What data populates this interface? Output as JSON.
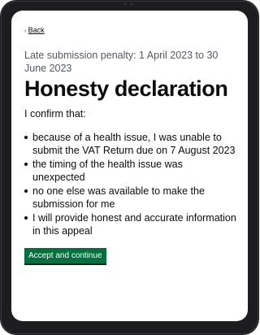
{
  "nav": {
    "back_label": "Back"
  },
  "page": {
    "caption": "Late submission penalty: 1 April 2023 to 30 June 2023",
    "title": "Honesty declaration",
    "intro": "I confirm that:",
    "bullets": [
      "because of a health issue, I was unable to submit the VAT Return due on 7 August 2023",
      "the timing of the health issue was unexpected",
      "no one else was available to make the submission for me",
      "I will provide honest and accurate information in this appeal"
    ]
  },
  "actions": {
    "continue_label": "Accept and continue"
  },
  "colors": {
    "button_green": "#00703c",
    "text": "#0b0c0c",
    "secondary_text": "#505a5f",
    "device_frame": "#1d1d1f"
  }
}
